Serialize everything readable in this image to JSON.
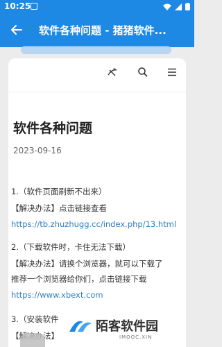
{
  "status_bar": {
    "time": "10:25"
  },
  "app_bar": {
    "title": "软件各种问题 - 猪猪软件..."
  },
  "toolbar": {
    "icons": [
      "theme-icon",
      "search-icon",
      "menu-icon"
    ]
  },
  "article": {
    "title": "软件各种问题",
    "date": "2023-09-16",
    "items": [
      {
        "question": "1.（软件页面刷新不出来）",
        "solution_line_1": "【解决办法】点击链接查看",
        "link": "https://tb.zhuzhugg.cc/index.php/13.html"
      },
      {
        "question": "2.（下载软件时，卡住无法下载）",
        "solution_line_1": "【解决办法】请换个浏览器，就可以下载了",
        "solution_line_2": "推荐一个浏览器给你们，点击链接下载",
        "link": "https://www.xbext.com"
      },
      {
        "question": "3.（安装软件",
        "solution_line_1": "【解决办法】"
      }
    ]
  },
  "watermark": {
    "name": "陌客软件园",
    "sub": "IMOOC.XIN"
  },
  "colors": {
    "primary": "#1e88e5",
    "link": "#2d7fbf"
  }
}
